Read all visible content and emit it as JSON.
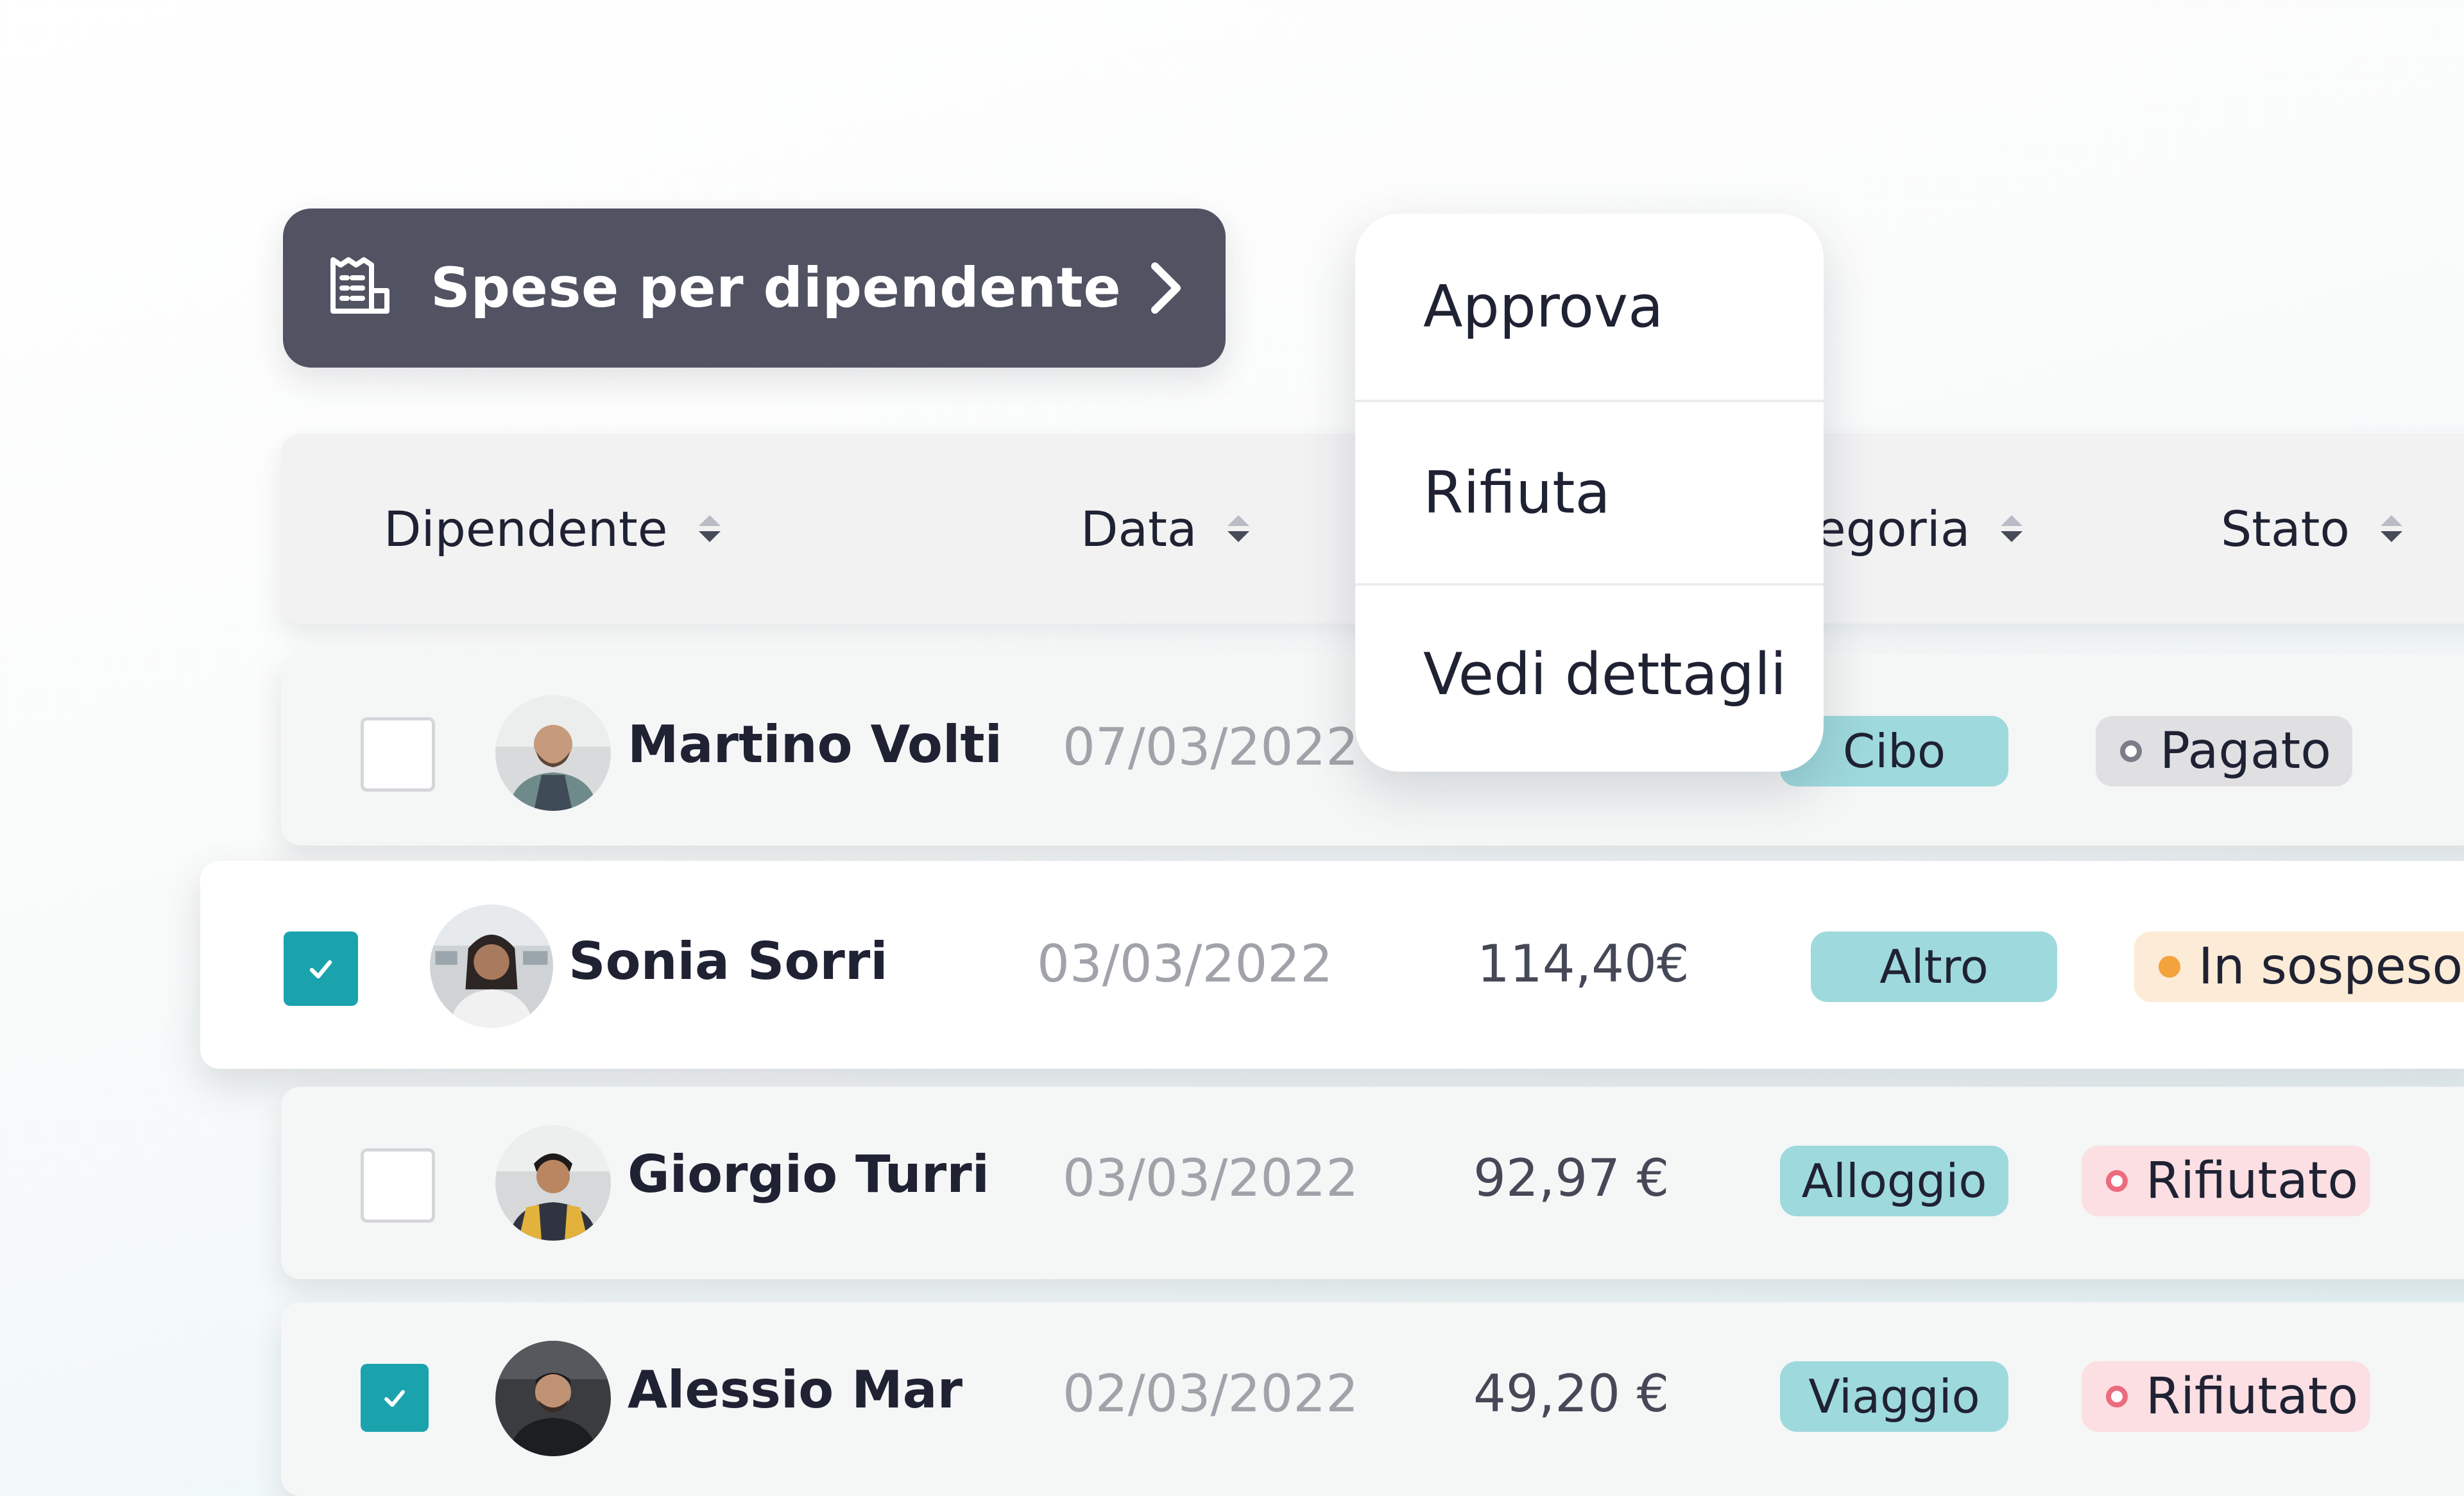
{
  "title_pill": {
    "label": "Spese per dipendente",
    "icon": "receipt-icon",
    "chevron": "chevron-right-icon"
  },
  "table": {
    "headers": [
      {
        "label": "Dipendente"
      },
      {
        "label": "Data"
      },
      {
        "label": "egoria"
      },
      {
        "label": "Stato"
      }
    ],
    "rows": [
      {
        "checked": false,
        "name": "Martino Volti",
        "date": "07/03/2022",
        "amount": ",",
        "category": "Cibo",
        "status": "Pagato",
        "status_kind": "paid"
      },
      {
        "checked": true,
        "name": "Sonia Sorri",
        "date": "03/03/2022",
        "amount": "114,40€",
        "category": "Altro",
        "status": "In sospeso",
        "status_kind": "pending"
      },
      {
        "checked": false,
        "name": "Giorgio Turri",
        "date": "03/03/2022",
        "amount": "92,97 €",
        "category": "Alloggio",
        "status": "Rifiutato",
        "status_kind": "rejected"
      },
      {
        "checked": true,
        "name": "Alessio Mar",
        "date": "02/03/2022",
        "amount": "49,20 €",
        "category": "Viaggio",
        "status": "Rifiutato",
        "status_kind": "rejected"
      }
    ]
  },
  "menu": {
    "items": [
      {
        "label": "Approva"
      },
      {
        "label": "Rifiuta"
      },
      {
        "label": "Vedi dettagli"
      }
    ]
  },
  "colors": {
    "pill": "#515262",
    "accent": "#1ba3ad",
    "tag": "#9ed9dd",
    "paid_bg": "#e0e0e3",
    "pending_bg": "#fcebd6",
    "pending_dot": "#f4a23c",
    "rejected_bg": "#fbdfe3",
    "rejected_dot": "#ec6b7e"
  }
}
